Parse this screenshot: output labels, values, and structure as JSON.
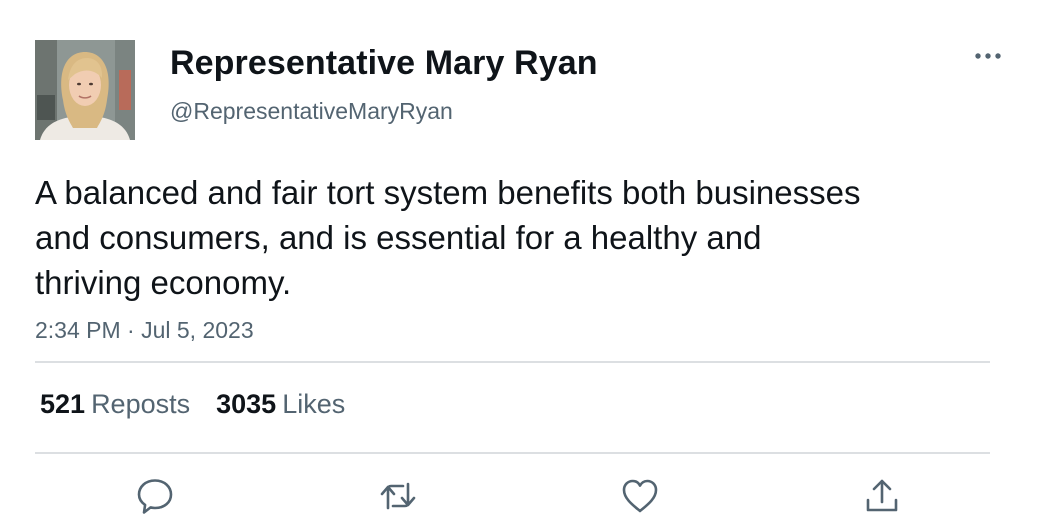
{
  "author": {
    "display_name": "Representative Mary Ryan",
    "handle": "@RepresentativeMaryRyan",
    "avatar_icon": "profile-photo"
  },
  "tweet": {
    "text": "A balanced and fair tort system benefits both businesses and consumers, and is essential for a healthy and thriving economy.",
    "timestamp": "2:34 PM · Jul 5, 2023"
  },
  "stats": {
    "reposts_count": "521",
    "reposts_label": "Reposts",
    "likes_count": "3035",
    "likes_label": "Likes"
  },
  "actions": {
    "reply_icon": "speech-bubble-icon",
    "repost_icon": "repost-arrows-icon",
    "like_icon": "heart-icon",
    "share_icon": "share-upload-icon",
    "more_icon": "ellipsis-icon"
  },
  "colors": {
    "text_primary": "#0f1419",
    "text_secondary": "#536471",
    "divider": "#dcdfe2",
    "icon": "#536471"
  }
}
